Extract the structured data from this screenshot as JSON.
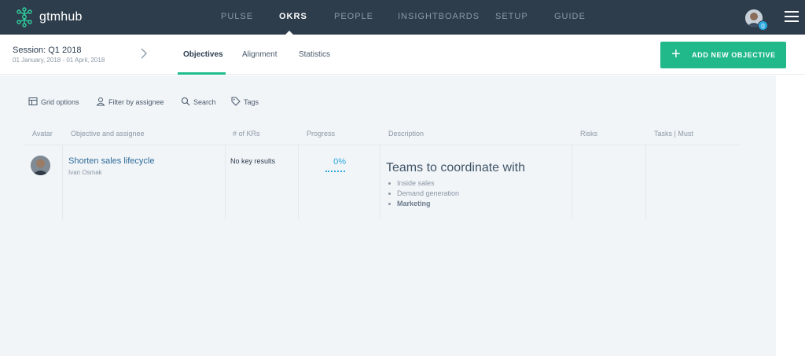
{
  "app": {
    "brand": "gtmhub",
    "nav": [
      {
        "label": "PULSE",
        "active": false
      },
      {
        "label": "OKRS",
        "active": true
      },
      {
        "label": "PEOPLE",
        "active": false
      },
      {
        "label": "INSIGHTBOARDS",
        "active": false
      },
      {
        "label": "SETUP",
        "active": false
      },
      {
        "label": "GUIDE",
        "active": false
      }
    ],
    "notification_count": "0"
  },
  "session": {
    "title": "Session: Q1 2018",
    "dates": "01 January, 2018 - 01 April, 2018"
  },
  "tabs": [
    {
      "label": "Objectives",
      "active": true
    },
    {
      "label": "Alignment",
      "active": false
    },
    {
      "label": "Statistics",
      "active": false
    }
  ],
  "add_button": {
    "label": "ADD NEW OBJECTIVE"
  },
  "toolbar": {
    "grid_options": "Grid options",
    "filter": "Filter by assignee",
    "search": "Search",
    "tags": "Tags"
  },
  "table": {
    "columns": [
      "Avatar",
      "Objective and assignee",
      "# of KRs",
      "Progress",
      "Description",
      "Risks",
      "Tasks | Must"
    ],
    "rows": [
      {
        "objective": "Shorten sales lifecycle",
        "assignee": "Ivan Osmak",
        "krs": "No key results",
        "progress": "0%",
        "description_title": "Teams to coordinate with",
        "description_items": [
          "Inside sales",
          "Demand generation",
          "Marketing"
        ]
      }
    ]
  },
  "colors": {
    "nav_bg": "#2e3d4c",
    "accent_green": "#22b98a",
    "accent_blue": "#2ca8e0",
    "content_bg": "#f2f5f8"
  },
  "icons": [
    "gtmhub-logo-icon",
    "chevron-right-icon",
    "plus-icon",
    "grid-icon",
    "user-icon",
    "search-icon",
    "tag-icon",
    "hamburger-menu-icon"
  ]
}
